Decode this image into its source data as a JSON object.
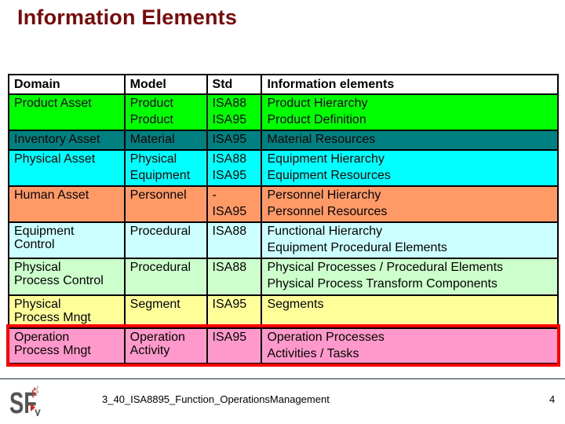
{
  "title": "Information Elements",
  "table": {
    "headers": [
      "Domain",
      "Model",
      "Std",
      "Information elements"
    ],
    "rows": [
      {
        "domain": "Product  Asset",
        "model": [
          "Product",
          "Product"
        ],
        "std": [
          "ISA88",
          "ISA95"
        ],
        "elements": [
          "Product Hierarchy",
          "Product Definition"
        ],
        "color": "#00ff00"
      },
      {
        "domain": "Inventory Asset",
        "model": [
          "Material"
        ],
        "std": [
          "ISA95"
        ],
        "elements": [
          "Material Resources"
        ],
        "color": "#008080"
      },
      {
        "domain": "Physical Asset",
        "model": [
          "Physical",
          "Equipment"
        ],
        "std": [
          "ISA88",
          "ISA95"
        ],
        "elements": [
          "Equipment Hierarchy",
          "Equipment Resources"
        ],
        "color": "#00ffff"
      },
      {
        "domain": "Human Asset",
        "model": [
          "Personnel"
        ],
        "std": [
          "-",
          "ISA95"
        ],
        "elements": [
          "Personnel Hierarchy",
          "Personnel Resources"
        ],
        "color": "#ff9966"
      },
      {
        "domain": [
          "Equipment",
          "Control"
        ],
        "model": [
          "Procedural"
        ],
        "std": [
          "ISA88"
        ],
        "elements": [
          "Functional Hierarchy",
          "Equipment Procedural Elements"
        ],
        "color": "#ccffff"
      },
      {
        "domain": [
          "Physical",
          "Process Control"
        ],
        "model": [
          "Procedural"
        ],
        "std": [
          "ISA88"
        ],
        "elements": [
          "Physical Processes / Procedural Elements",
          "Physical Process Transform Components"
        ],
        "color": "#ccffcc"
      },
      {
        "domain": [
          "Physical",
          "Process Mngt"
        ],
        "model": [
          "Segment"
        ],
        "std": [
          "ISA95"
        ],
        "elements": [
          "Segments"
        ],
        "color": "#ffff99"
      },
      {
        "domain": [
          "Operation",
          "Process Mngt"
        ],
        "model": [
          "Operation",
          "Activity"
        ],
        "std": [
          "ISA95"
        ],
        "elements": [
          "Operation Processes",
          "Activities / Tasks"
        ],
        "color": "#ff99cc",
        "highlighted": true
      }
    ]
  },
  "highlight_color": "#ff0000",
  "footer": {
    "logo_text": "SFy",
    "document_name": "3_40_ISA8895_Function_OperationsManagement",
    "page_number": "4"
  }
}
